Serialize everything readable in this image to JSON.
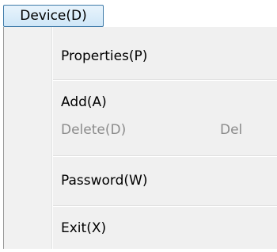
{
  "menubar": {
    "device_label": "Device(D)"
  },
  "menu": {
    "items": [
      {
        "label": "Properties(P)",
        "shortcut": "",
        "enabled": true
      },
      {
        "label": "Add(A)",
        "shortcut": "",
        "enabled": true
      },
      {
        "label": "Delete(D)",
        "shortcut": "Del",
        "enabled": false
      },
      {
        "label": "Password(W)",
        "shortcut": "",
        "enabled": true
      },
      {
        "label": "Exit(X)",
        "shortcut": "",
        "enabled": true
      }
    ]
  },
  "colors": {
    "menubar_highlight_border": "#3e7aa8",
    "disabled_text": "#8c8c8c",
    "menu_background": "#f0f0f0"
  }
}
